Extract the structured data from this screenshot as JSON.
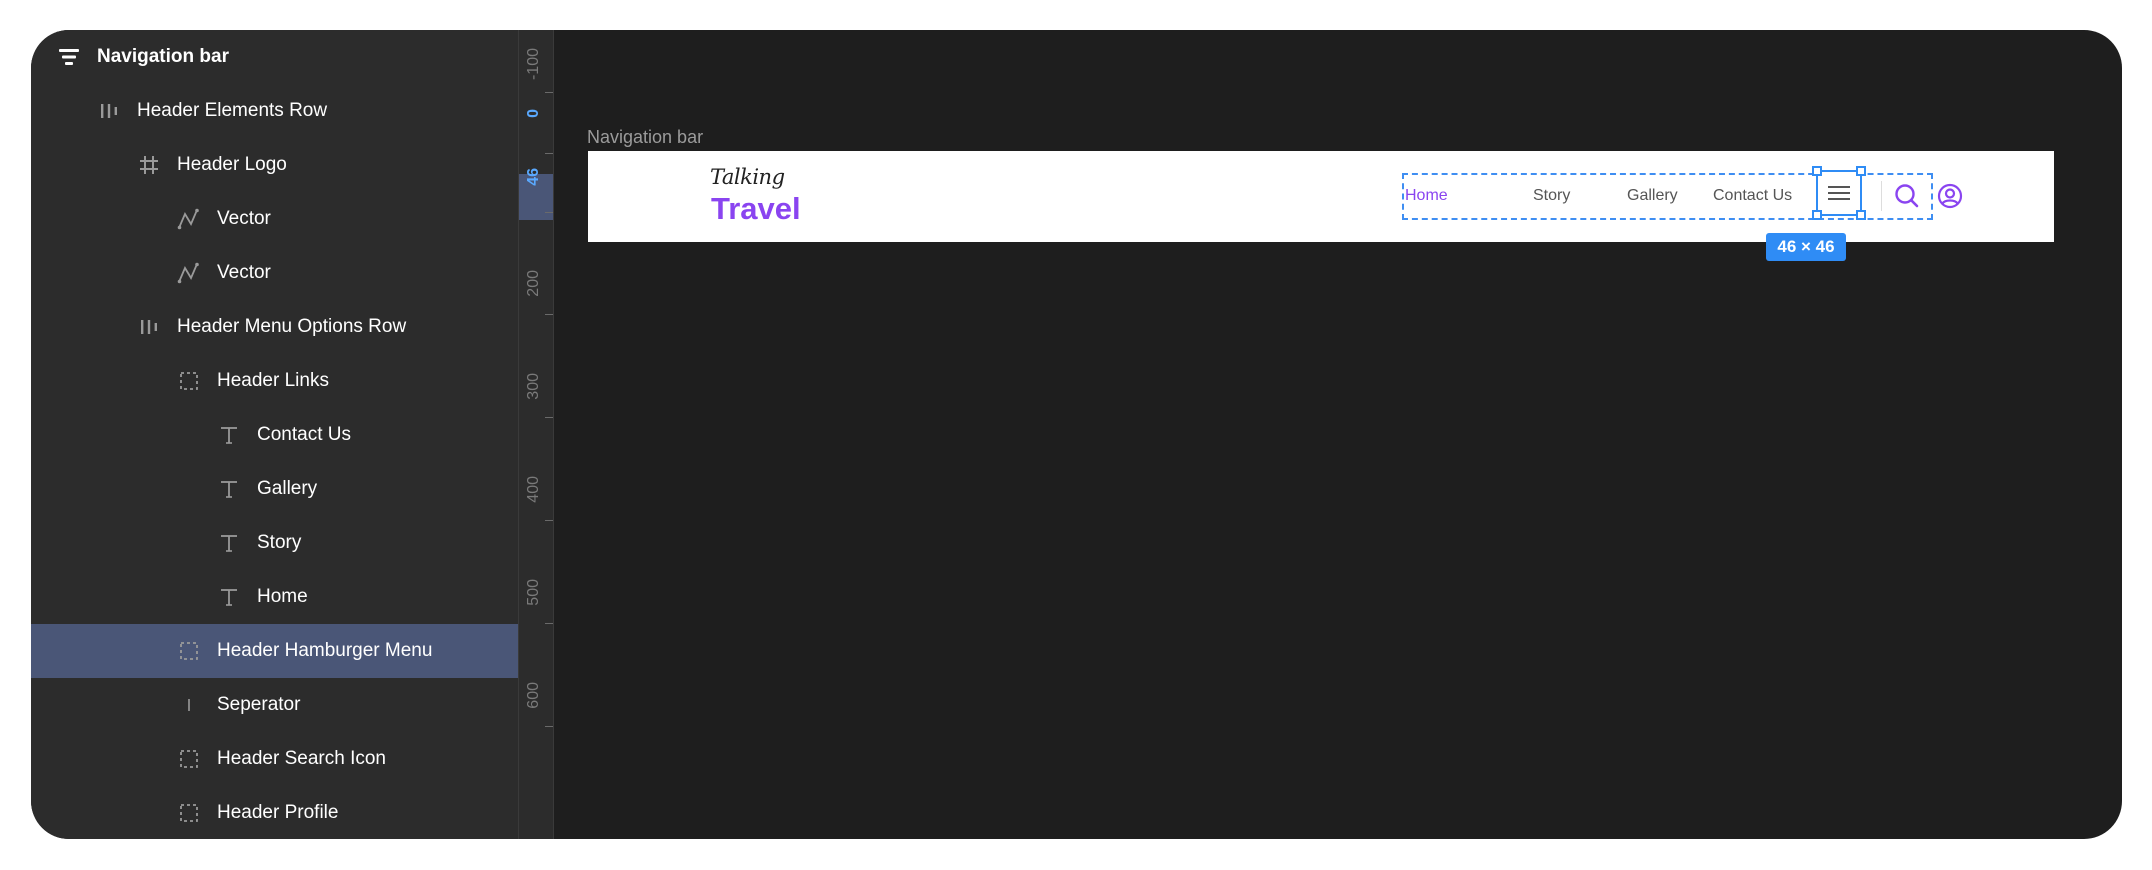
{
  "layers": [
    {
      "label": "Navigation bar",
      "icon": "frame-list-icon",
      "indent": 0
    },
    {
      "label": "Header Elements Row",
      "icon": "horizontal-stack-icon",
      "indent": 1
    },
    {
      "label": "Header Logo",
      "icon": "frame-hash-icon",
      "indent": 2
    },
    {
      "label": "Vector",
      "icon": "vector-pen-icon",
      "indent": 3
    },
    {
      "label": "Vector",
      "icon": "vector-pen-icon",
      "indent": 3
    },
    {
      "label": "Header Menu Options Row",
      "icon": "horizontal-stack-icon",
      "indent": 2
    },
    {
      "label": "Header Links",
      "icon": "dashed-frame-icon",
      "indent": 3
    },
    {
      "label": "Contact Us",
      "icon": "text-icon",
      "indent": 4
    },
    {
      "label": "Gallery",
      "icon": "text-icon",
      "indent": 4
    },
    {
      "label": "Story",
      "icon": "text-icon",
      "indent": 4
    },
    {
      "label": "Home",
      "icon": "text-icon",
      "indent": 4
    },
    {
      "label": "Header Hamburger Menu",
      "icon": "dashed-frame-icon",
      "indent": 3,
      "selected": true
    },
    {
      "label": "Seperator",
      "icon": "line-icon",
      "indent": 3
    },
    {
      "label": "Header Search Icon",
      "icon": "dashed-frame-icon",
      "indent": 3
    },
    {
      "label": "Header Profile",
      "icon": "dashed-frame-icon",
      "indent": 3
    }
  ],
  "ruler": {
    "ticks": [
      "-100",
      "0",
      "46",
      "200",
      "300",
      "400",
      "500",
      "600"
    ],
    "highlighted": [
      "0",
      "46"
    ]
  },
  "canvas": {
    "frame_label": "Navigation bar",
    "logo_script": "Talking",
    "logo_main": "Travel",
    "nav_links": [
      "Home",
      "Story",
      "Gallery",
      "Contact Us"
    ],
    "active_link": "Home",
    "selection_size": "46 × 46"
  },
  "colors": {
    "accent_purple": "#8a44f0",
    "selection_blue": "#2f8cf5",
    "panel_bg": "#2c2c2c",
    "canvas_bg": "#1e1e1e",
    "selected_row": "#4a5677"
  }
}
